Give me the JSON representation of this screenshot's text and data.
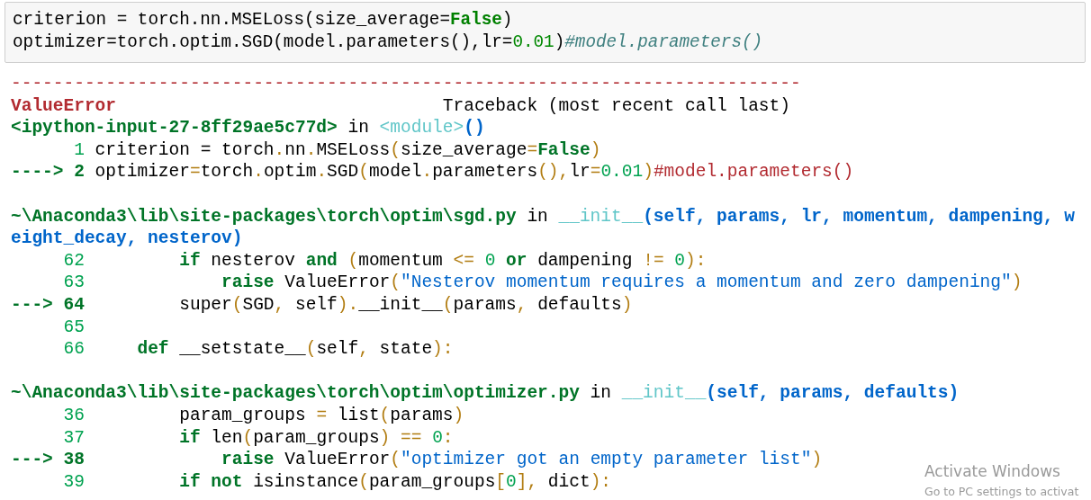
{
  "input_cell": {
    "lines": [
      [
        {
          "t": "criterion = torch.nn.MSELoss(size_average=",
          "kind": "plain"
        },
        {
          "t": "False",
          "kind": "keyword"
        },
        {
          "t": ")",
          "kind": "plain"
        }
      ],
      [
        {
          "t": "optimizer=torch.optim.SGD(model.parameters(),lr=",
          "kind": "plain"
        },
        {
          "t": "0.01",
          "kind": "number"
        },
        {
          "t": ")",
          "kind": "plain"
        },
        {
          "t": "#model.parameters()",
          "kind": "comment"
        }
      ]
    ]
  },
  "output": {
    "lines": [
      {
        "kind": "code",
        "segs": [
          {
            "t": "---------------------------------------------------------------------------",
            "kind": "err"
          }
        ]
      },
      {
        "kind": "code",
        "segs": [
          {
            "t": "ValueError",
            "kind": "errname"
          },
          {
            "t": "                               Traceback (most recent call last)",
            "kind": "plain"
          }
        ]
      },
      {
        "kind": "code",
        "segs": [
          {
            "t": "<ipython-input-27-8ff29ae5c77d>",
            "kind": "path"
          },
          {
            "t": " in ",
            "kind": "plain"
          },
          {
            "t": "<module>",
            "kind": "cyan"
          },
          {
            "t": "()",
            "kind": "args"
          }
        ]
      },
      {
        "kind": "code",
        "segs": [
          {
            "t": "      1",
            "kind": "lineno"
          },
          {
            "t": " criterion = torch",
            "kind": "plain"
          },
          {
            "t": ".",
            "kind": "punct"
          },
          {
            "t": "nn",
            "kind": "plain"
          },
          {
            "t": ".",
            "kind": "punct"
          },
          {
            "t": "MSELoss",
            "kind": "plain"
          },
          {
            "t": "(",
            "kind": "punct"
          },
          {
            "t": "size_average",
            "kind": "plain"
          },
          {
            "t": "=",
            "kind": "punct"
          },
          {
            "t": "False",
            "kind": "kw"
          },
          {
            "t": ")",
            "kind": "punct"
          }
        ]
      },
      {
        "kind": "code",
        "segs": [
          {
            "t": "----> 2",
            "kind": "arrow"
          },
          {
            "t": " optimizer",
            "kind": "plain"
          },
          {
            "t": "=",
            "kind": "punct"
          },
          {
            "t": "torch",
            "kind": "plain"
          },
          {
            "t": ".",
            "kind": "punct"
          },
          {
            "t": "optim",
            "kind": "plain"
          },
          {
            "t": ".",
            "kind": "punct"
          },
          {
            "t": "SGD",
            "kind": "plain"
          },
          {
            "t": "(",
            "kind": "punct"
          },
          {
            "t": "model",
            "kind": "plain"
          },
          {
            "t": ".",
            "kind": "punct"
          },
          {
            "t": "parameters",
            "kind": "plain"
          },
          {
            "t": "(),",
            "kind": "punct"
          },
          {
            "t": "lr",
            "kind": "plain"
          },
          {
            "t": "=",
            "kind": "punct"
          },
          {
            "t": "0.01",
            "kind": "num"
          },
          {
            "t": ")",
            "kind": "punct"
          },
          {
            "t": "#model.parameters()",
            "kind": "comment"
          }
        ]
      },
      {
        "kind": "blank"
      },
      {
        "kind": "code",
        "segs": [
          {
            "t": "~\\Anaconda3\\lib\\site-packages\\torch\\optim\\sgd.py",
            "kind": "path"
          },
          {
            "t": " in ",
            "kind": "plain"
          },
          {
            "t": "__init__",
            "kind": "cyan"
          },
          {
            "t": "(self, params, lr, momentum, dampening, weight_decay, nesterov)",
            "kind": "args"
          }
        ]
      },
      {
        "kind": "code",
        "segs": [
          {
            "t": "     62         ",
            "kind": "lineno"
          },
          {
            "t": "if",
            "kind": "kw"
          },
          {
            "t": " nesterov ",
            "kind": "plain"
          },
          {
            "t": "and",
            "kind": "kw"
          },
          {
            "t": " (",
            "kind": "punct"
          },
          {
            "t": "momentum ",
            "kind": "plain"
          },
          {
            "t": "<= ",
            "kind": "punct"
          },
          {
            "t": "0 ",
            "kind": "num"
          },
          {
            "t": "or",
            "kind": "kw"
          },
          {
            "t": " dampening ",
            "kind": "plain"
          },
          {
            "t": "!= ",
            "kind": "punct"
          },
          {
            "t": "0",
            "kind": "num"
          },
          {
            "t": "):",
            "kind": "punct"
          }
        ]
      },
      {
        "kind": "code",
        "segs": [
          {
            "t": "     63             ",
            "kind": "lineno"
          },
          {
            "t": "raise",
            "kind": "kw"
          },
          {
            "t": " ValueError",
            "kind": "plain"
          },
          {
            "t": "(",
            "kind": "punct"
          },
          {
            "t": "\"Nesterov momentum requires a momentum and zero dampening\"",
            "kind": "string"
          },
          {
            "t": ")",
            "kind": "punct"
          }
        ]
      },
      {
        "kind": "code",
        "segs": [
          {
            "t": "---> 64",
            "kind": "arrow"
          },
          {
            "t": "         super",
            "kind": "plain"
          },
          {
            "t": "(",
            "kind": "punct"
          },
          {
            "t": "SGD",
            "kind": "plain"
          },
          {
            "t": ",",
            "kind": "punct"
          },
          {
            "t": " self",
            "kind": "plain"
          },
          {
            "t": ").",
            "kind": "punct"
          },
          {
            "t": "__init__",
            "kind": "plain"
          },
          {
            "t": "(",
            "kind": "punct"
          },
          {
            "t": "params",
            "kind": "plain"
          },
          {
            "t": ",",
            "kind": "punct"
          },
          {
            "t": " defaults",
            "kind": "plain"
          },
          {
            "t": ")",
            "kind": "punct"
          }
        ]
      },
      {
        "kind": "code",
        "segs": [
          {
            "t": "     65",
            "kind": "lineno"
          }
        ]
      },
      {
        "kind": "code",
        "segs": [
          {
            "t": "     66     ",
            "kind": "lineno"
          },
          {
            "t": "def",
            "kind": "kw"
          },
          {
            "t": " __setstate__",
            "kind": "plain"
          },
          {
            "t": "(",
            "kind": "punct"
          },
          {
            "t": "self",
            "kind": "plain"
          },
          {
            "t": ",",
            "kind": "punct"
          },
          {
            "t": " state",
            "kind": "plain"
          },
          {
            "t": "):",
            "kind": "punct"
          }
        ]
      },
      {
        "kind": "blank"
      },
      {
        "kind": "code",
        "segs": [
          {
            "t": "~\\Anaconda3\\lib\\site-packages\\torch\\optim\\optimizer.py",
            "kind": "path"
          },
          {
            "t": " in ",
            "kind": "plain"
          },
          {
            "t": "__init__",
            "kind": "cyan"
          },
          {
            "t": "(self, params, defaults)",
            "kind": "args"
          }
        ]
      },
      {
        "kind": "code",
        "segs": [
          {
            "t": "     36",
            "kind": "lineno"
          },
          {
            "t": "         param_groups ",
            "kind": "plain"
          },
          {
            "t": "=",
            "kind": "punct"
          },
          {
            "t": " list",
            "kind": "plain"
          },
          {
            "t": "(",
            "kind": "punct"
          },
          {
            "t": "params",
            "kind": "plain"
          },
          {
            "t": ")",
            "kind": "punct"
          }
        ]
      },
      {
        "kind": "code",
        "segs": [
          {
            "t": "     37         ",
            "kind": "lineno"
          },
          {
            "t": "if",
            "kind": "kw"
          },
          {
            "t": " len",
            "kind": "plain"
          },
          {
            "t": "(",
            "kind": "punct"
          },
          {
            "t": "param_groups",
            "kind": "plain"
          },
          {
            "t": ") == ",
            "kind": "punct"
          },
          {
            "t": "0",
            "kind": "num"
          },
          {
            "t": ":",
            "kind": "punct"
          }
        ]
      },
      {
        "kind": "code",
        "segs": [
          {
            "t": "---> 38             ",
            "kind": "arrow"
          },
          {
            "t": "raise",
            "kind": "kw"
          },
          {
            "t": " ValueError",
            "kind": "plain"
          },
          {
            "t": "(",
            "kind": "punct"
          },
          {
            "t": "\"optimizer got an empty parameter list\"",
            "kind": "string"
          },
          {
            "t": ")",
            "kind": "punct"
          }
        ]
      },
      {
        "kind": "code",
        "segs": [
          {
            "t": "     39         ",
            "kind": "lineno"
          },
          {
            "t": "if not",
            "kind": "kw"
          },
          {
            "t": " isinstance",
            "kind": "plain"
          },
          {
            "t": "(",
            "kind": "punct"
          },
          {
            "t": "param_groups",
            "kind": "plain"
          },
          {
            "t": "[",
            "kind": "punct"
          },
          {
            "t": "0",
            "kind": "num"
          },
          {
            "t": "],",
            "kind": "punct"
          },
          {
            "t": " dict",
            "kind": "plain"
          },
          {
            "t": "):",
            "kind": "punct"
          }
        ]
      }
    ]
  },
  "os_notice": {
    "title": "Activate Windows",
    "subtitle": "Go to PC settings to activat"
  }
}
